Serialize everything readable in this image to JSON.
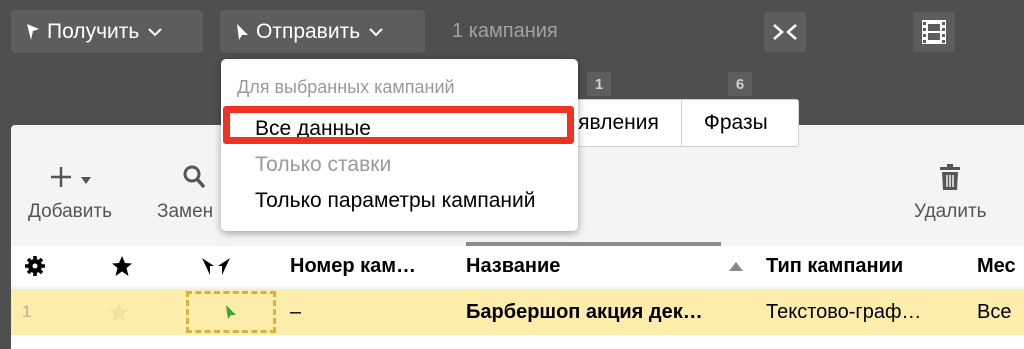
{
  "toolbar": {
    "get_label": "Получить",
    "send_label": "Отправить",
    "campaign_count": "1 кампания"
  },
  "tabs": [
    {
      "badge": "1",
      "label": "Объявления",
      "visible_label": "явления"
    },
    {
      "badge": "6",
      "label": "Фразы"
    }
  ],
  "tools": {
    "add": "Добавить",
    "replace": "Замен",
    "delete": "Удалить"
  },
  "dropdown": {
    "caption": "Для выбранных кампаний",
    "items": [
      {
        "label": "Все данные",
        "highlighted": true
      },
      {
        "label": "Только ставки",
        "disabled": true
      },
      {
        "label": "Только параметры кампаний"
      }
    ]
  },
  "table": {
    "columns": [
      "Номер кам…",
      "Название",
      "Тип кампании",
      "Мес"
    ],
    "rows": [
      {
        "index": "1",
        "number": "–",
        "name": "Барбершоп акция дек…",
        "type": "Текстово-граф…",
        "extra": "Все"
      }
    ]
  },
  "colors": {
    "highlight_border": "#f03320",
    "row_selected": "#fcedab",
    "send_icon": "#3aa52b"
  }
}
